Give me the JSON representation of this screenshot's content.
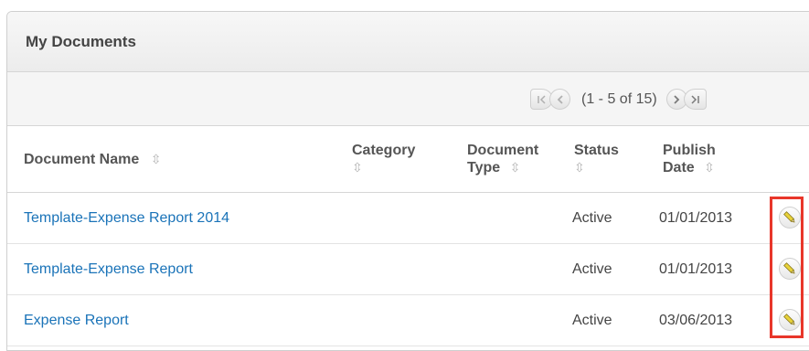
{
  "dashlet": {
    "title": "My Documents"
  },
  "pagination": {
    "summary": "(1 - 5 of 15)",
    "first_icon": "first-page-icon",
    "prev_icon": "previous-page-icon",
    "next_icon": "next-page-icon",
    "last_icon": "last-page-icon"
  },
  "columns": {
    "document_name": "Document Name",
    "category": "Category",
    "document_type_line1": "Document",
    "document_type_line2": "Type",
    "status": "Status",
    "publish_date_line1": "Publish",
    "publish_date_line2": "Date",
    "sort_glyph": "⇳"
  },
  "rows": [
    {
      "name": "Template-Expense Report 2014",
      "category": "",
      "type": "",
      "status": "Active",
      "publish_date": "01/01/2013",
      "action_icon": "pencil-icon"
    },
    {
      "name": "Template-Expense Report",
      "category": "",
      "type": "",
      "status": "Active",
      "publish_date": "01/01/2013",
      "action_icon": "pencil-icon"
    },
    {
      "name": "Expense Report",
      "category": "",
      "type": "",
      "status": "Active",
      "publish_date": "03/06/2013",
      "action_icon": "pencil-icon"
    }
  ],
  "colors": {
    "link": "#1a73b8",
    "highlight": "#e8362a",
    "pencil": "#e8d23a"
  }
}
